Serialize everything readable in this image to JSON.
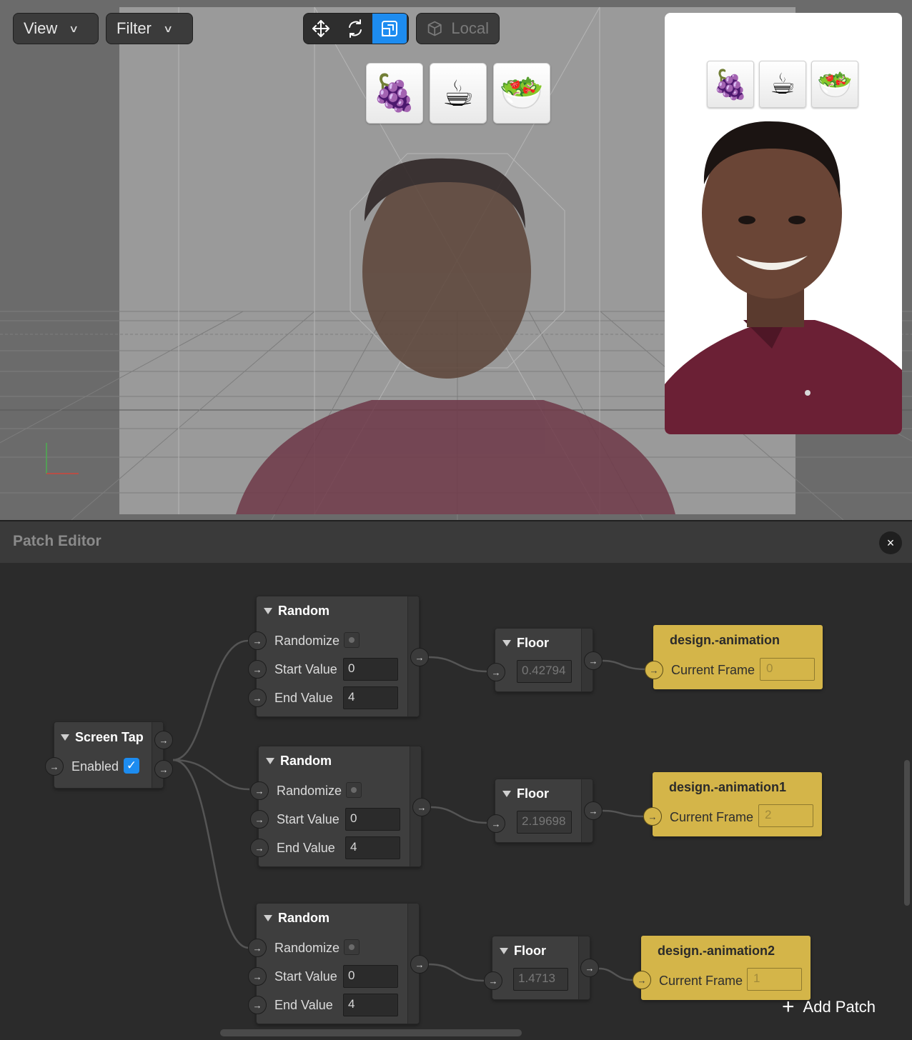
{
  "viewport": {
    "view_menu": "View",
    "filter_menu": "Filter",
    "transform_tools": [
      {
        "icon": "move-icon",
        "active": false
      },
      {
        "icon": "rotate-icon",
        "active": false
      },
      {
        "icon": "scale-icon",
        "active": true
      }
    ],
    "space_button": "Local",
    "space_icon": "cube-icon",
    "emoji_buttons": [
      "🍇",
      "☕",
      "🥗"
    ]
  },
  "preview": {
    "emoji_buttons": [
      "🍇",
      "☕",
      "🥗"
    ]
  },
  "patch_editor": {
    "title": "Patch Editor",
    "close_icon": "×",
    "add_patch_label": "Add Patch",
    "screen_tap": {
      "title": "Screen Tap",
      "enabled_label": "Enabled",
      "enabled": true
    },
    "random_nodes": [
      {
        "title": "Random",
        "randomize_label": "Randomize",
        "start_label": "Start Value",
        "start_value": "0",
        "end_label": "End Value",
        "end_value": "4"
      },
      {
        "title": "Random",
        "randomize_label": "Randomize",
        "start_label": "Start Value",
        "start_value": "0",
        "end_label": "End Value",
        "end_value": "4"
      },
      {
        "title": "Random",
        "randomize_label": "Randomize",
        "start_label": "Start Value",
        "start_value": "0",
        "end_label": "End Value",
        "end_value": "4"
      }
    ],
    "floor_nodes": [
      {
        "title": "Floor",
        "value": "0.42794"
      },
      {
        "title": "Floor",
        "value": "2.19698"
      },
      {
        "title": "Floor",
        "value": "1.4713"
      }
    ],
    "asset_nodes": [
      {
        "title": "design.-animation",
        "frame_label": "Current Frame",
        "frame_value": "0"
      },
      {
        "title": "design.-animation1",
        "frame_label": "Current Frame",
        "frame_value": "2"
      },
      {
        "title": "design.-animation2",
        "frame_label": "Current Frame",
        "frame_value": "1"
      }
    ]
  },
  "colors": {
    "accent_blue": "#1d8cf0",
    "asset_gold": "#d4b549",
    "panel_dark": "#2b2b2b",
    "node_bg": "#3e3e3e"
  }
}
